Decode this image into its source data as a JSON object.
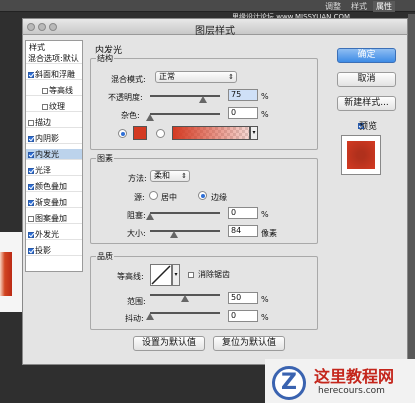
{
  "host_app": {
    "tabs": [
      "调整",
      "样式",
      "属性"
    ],
    "active_tab_index": 2,
    "watermark_top": "思缘设计论坛 www.MISSYUAN.COM"
  },
  "dialog": {
    "title": "图层样式",
    "styles_header": "样式",
    "styles": [
      {
        "label": "混合选项:默认",
        "has_checkbox": false,
        "checked": false,
        "indent": false,
        "selected": false
      },
      {
        "label": "斜面和浮雕",
        "has_checkbox": true,
        "checked": true,
        "indent": false,
        "selected": false
      },
      {
        "label": "等高线",
        "has_checkbox": true,
        "checked": false,
        "indent": true,
        "selected": false
      },
      {
        "label": "纹理",
        "has_checkbox": true,
        "checked": false,
        "indent": true,
        "selected": false
      },
      {
        "label": "描边",
        "has_checkbox": true,
        "checked": false,
        "indent": false,
        "selected": false
      },
      {
        "label": "内阴影",
        "has_checkbox": true,
        "checked": true,
        "indent": false,
        "selected": false
      },
      {
        "label": "内发光",
        "has_checkbox": true,
        "checked": true,
        "indent": false,
        "selected": true
      },
      {
        "label": "光泽",
        "has_checkbox": true,
        "checked": true,
        "indent": false,
        "selected": false
      },
      {
        "label": "颜色叠加",
        "has_checkbox": true,
        "checked": true,
        "indent": false,
        "selected": false
      },
      {
        "label": "渐变叠加",
        "has_checkbox": true,
        "checked": true,
        "indent": false,
        "selected": false
      },
      {
        "label": "图案叠加",
        "has_checkbox": true,
        "checked": false,
        "indent": false,
        "selected": false
      },
      {
        "label": "外发光",
        "has_checkbox": true,
        "checked": true,
        "indent": false,
        "selected": false
      },
      {
        "label": "投影",
        "has_checkbox": true,
        "checked": true,
        "indent": false,
        "selected": false
      }
    ],
    "inner_glow": {
      "title": "内发光",
      "structure": {
        "title": "结构",
        "blend_mode_label": "混合模式:",
        "blend_mode_value": "正常",
        "opacity_label": "不透明度:",
        "opacity_value": "75",
        "opacity_slider": 0.75,
        "noise_label": "杂色:",
        "noise_value": "0",
        "noise_slider": 0,
        "unit": "%",
        "color_radio_selected": true,
        "gradient_radio_selected": false,
        "glow_color": "#d43a22"
      },
      "elements": {
        "title": "图素",
        "method_label": "方法:",
        "method_value": "柔和",
        "source_label": "源:",
        "source_center": "居中",
        "source_edge": "边缘",
        "source_selected": "edge",
        "choke_label": "阻塞:",
        "choke_value": "0",
        "choke_slider": 0,
        "size_label": "大小:",
        "size_value": "84",
        "size_slider": 0.34,
        "size_unit": "像素",
        "unit": "%"
      },
      "quality": {
        "title": "品质",
        "contour_label": "等高线:",
        "antialias_label": "消除锯齿",
        "antialias_checked": false,
        "range_label": "范围:",
        "range_value": "50",
        "range_slider": 0.5,
        "jitter_label": "抖动:",
        "jitter_value": "0",
        "jitter_slider": 0,
        "unit": "%"
      },
      "make_default": "设置为默认值",
      "reset_default": "复位为默认值"
    },
    "buttons": {
      "ok": "确定",
      "cancel": "取消",
      "new_style": "新建样式...",
      "preview_label": "预览",
      "preview_checked": true
    }
  },
  "watermark": {
    "title": "这里教程网",
    "url": "herecours.com",
    "logo_letter": "Z"
  }
}
